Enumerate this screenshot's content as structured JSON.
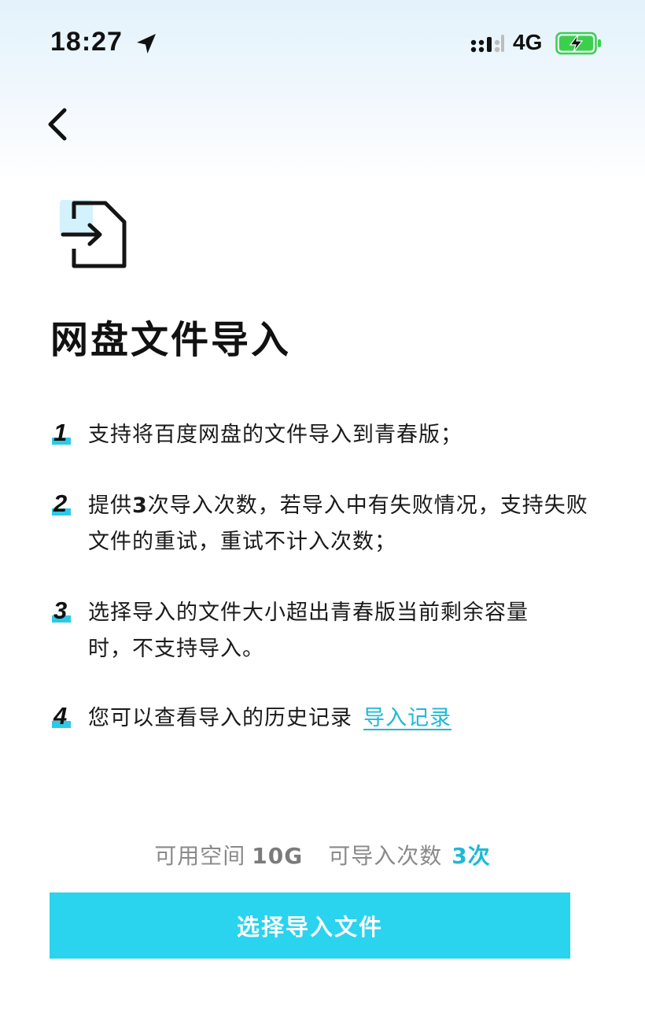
{
  "status_bar": {
    "time": "18:27",
    "network": "4G",
    "icons": [
      "location-arrow-icon",
      "cellular-signal-icon",
      "battery-charging-icon"
    ]
  },
  "nav": {
    "back_icon": "chevron-left-icon"
  },
  "header": {
    "icon": "file-import-icon",
    "title": "网盘文件导入"
  },
  "steps": [
    {
      "number": "1",
      "text": "支持将百度网盘的文件导入到青春版；"
    },
    {
      "number": "2",
      "text_before": "提供",
      "highlight": "3",
      "text_after": "次导入次数，若导入中有失败情况，支持失败文件的重试，重试不计入次数；"
    },
    {
      "number": "3",
      "text": "选择导入的文件大小超出青春版当前剩余容量时，不支持导入。"
    },
    {
      "number": "4",
      "text": "您可以查看导入的历史记录",
      "link": "导入记录"
    }
  ],
  "quota": {
    "space_label": "可用空间",
    "space_value": "10G",
    "count_label": "可导入次数",
    "count_value": "3次"
  },
  "action": {
    "button_label": "选择导入文件"
  },
  "colors": {
    "accent": "#2ad3ee",
    "link": "#1fb8d8",
    "battery": "#3ccf4e"
  }
}
